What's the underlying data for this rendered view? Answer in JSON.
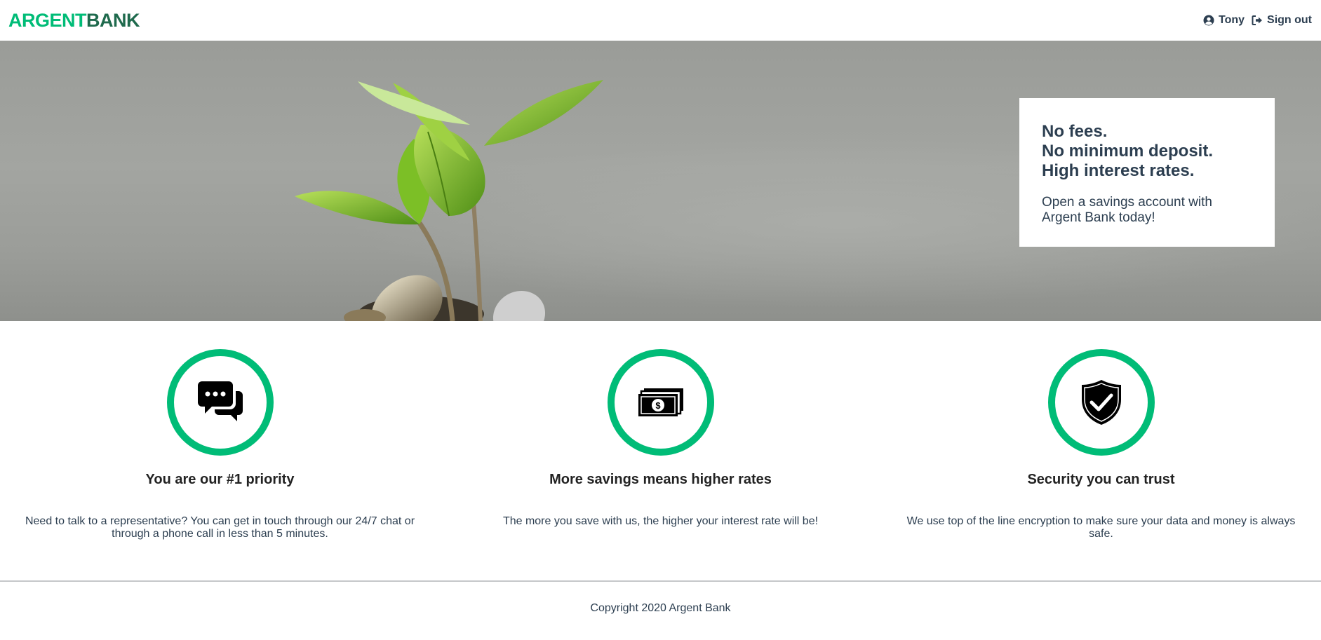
{
  "header": {
    "logo_part1": "ARGENT",
    "logo_part2": "BANK",
    "user_name": "Tony",
    "sign_out_label": "Sign out",
    "user_icon": "user-circle-icon",
    "sign_out_icon": "sign-out-icon"
  },
  "hero": {
    "subtitles": [
      "No fees.",
      "No minimum deposit.",
      "High interest rates."
    ],
    "text": "Open a savings account with Argent Bank today!"
  },
  "features": [
    {
      "icon": "chat-icon",
      "title": "You are our #1 priority",
      "text": "Need to talk to a representative? You can get in touch through our 24/7 chat or through a phone call in less than 5 minutes."
    },
    {
      "icon": "money-icon",
      "title": "More savings means higher rates",
      "text": "The more you save with us, the higher your interest rate will be!"
    },
    {
      "icon": "security-shield-icon",
      "title": "Security you can trust",
      "text": "We use top of the line encryption to make sure your data and money is always safe."
    }
  ],
  "footer": {
    "copyright": "Copyright 2020 Argent Bank"
  },
  "colors": {
    "brand_green": "#00bc77",
    "brand_dark_green": "#1f6a4d",
    "text_dark": "#2c3e50"
  }
}
